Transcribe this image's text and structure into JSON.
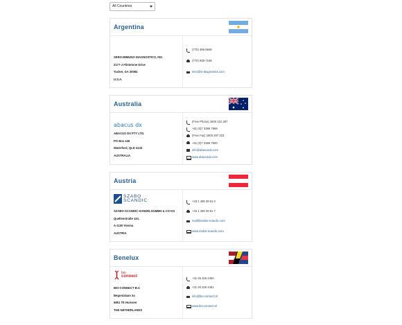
{
  "filter": {
    "selected": "All Countries"
  },
  "cards": [
    {
      "country": "Argentina",
      "address": [
        "SERO-IMMUNO DIAGNOSTICS, INC.",
        "2177-J Flintstone Drive",
        "Tucker, GA 30084",
        "U.S.A."
      ],
      "contacts": [
        {
          "icon": "phone-icon",
          "text": "(770) 496-5848"
        },
        {
          "icon": "fax-icon",
          "text": "(770) 938-7189"
        },
        {
          "icon": "email-icon",
          "text": "sero@si-diagnostics.com"
        }
      ]
    },
    {
      "country": "Australia",
      "logo_text": "abacus dx",
      "address": [
        "ABACUS DX PTY LTD.",
        "PO Box 446",
        "Waterford, QLD 4133",
        "AUSTRALIA"
      ],
      "contacts": [
        {
          "icon": "phone-icon",
          "text": "(Free Phone) 1800 222 287"
        },
        {
          "icon": "phone-icon",
          "text": "+61 (0)7 3386 7999"
        },
        {
          "icon": "fax-icon",
          "text": "(Free Fax) 1800 287 223"
        },
        {
          "icon": "fax-icon",
          "text": "+61 (0)7 3386 7900"
        },
        {
          "icon": "email-icon",
          "text": "info@abacusdx.com"
        },
        {
          "icon": "web-icon",
          "text": "www.abacusdx.com"
        }
      ]
    },
    {
      "country": "Austria",
      "logo_text": [
        "SZABO",
        "SCANDIC"
      ],
      "address": [
        "SZABO-SCANDIC HANDELSGMBH & CO KG",
        "Quellenstraße 110,",
        "A-1100 Vienna",
        "AUSTRIA"
      ],
      "contacts": [
        {
          "icon": "phone-icon",
          "text": "+43 1 489 39 61 0"
        },
        {
          "icon": "fax-icon",
          "text": "+43 1 489 39 61 7"
        },
        {
          "icon": "email-icon",
          "text": "mail@szabo-scandic.com"
        },
        {
          "icon": "web-icon",
          "text": "www.szabo-scandic.com"
        }
      ]
    },
    {
      "country": "Benelux",
      "logo_text": [
        "bio",
        "connect"
      ],
      "address": [
        "BIO-CONNECT B.V.",
        "Begonialaan 3a",
        "6851 TE Huissen",
        "THE NETHERLANDS"
      ],
      "contacts": [
        {
          "icon": "phone-icon",
          "text": "+31 26 326 4450"
        },
        {
          "icon": "fax-icon",
          "text": "+31 26 326 4451"
        },
        {
          "icon": "email-icon",
          "text": "info@bio-connect.nl"
        },
        {
          "icon": "web-icon",
          "text": "www.bio-connect.nl"
        }
      ]
    }
  ],
  "colors": {
    "heading": "#2a6090",
    "border": "#e2e2e2"
  }
}
